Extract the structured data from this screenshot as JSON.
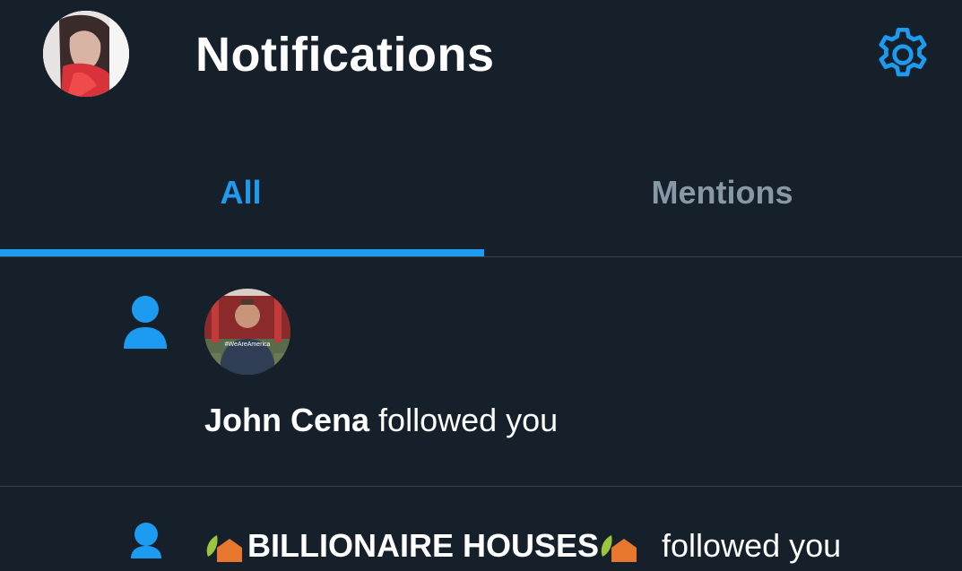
{
  "header": {
    "title": "Notifications",
    "avatar_icon": "user-avatar",
    "settings_icon": "gear-icon"
  },
  "tabs": [
    {
      "label": "All",
      "active": true
    },
    {
      "label": "Mentions",
      "active": false
    }
  ],
  "notifications": [
    {
      "type_icon": "person-icon",
      "avatar_caption": "#WeAreAmerica",
      "name": "John Cena",
      "action": "followed you"
    },
    {
      "type_icon": "person-icon",
      "name": "BILLIONAIRE HOUSES",
      "action": "followed you"
    }
  ],
  "colors": {
    "background": "#15202b",
    "accent": "#1d9bf0",
    "muted": "#8899a6",
    "divider": "#38444d"
  }
}
